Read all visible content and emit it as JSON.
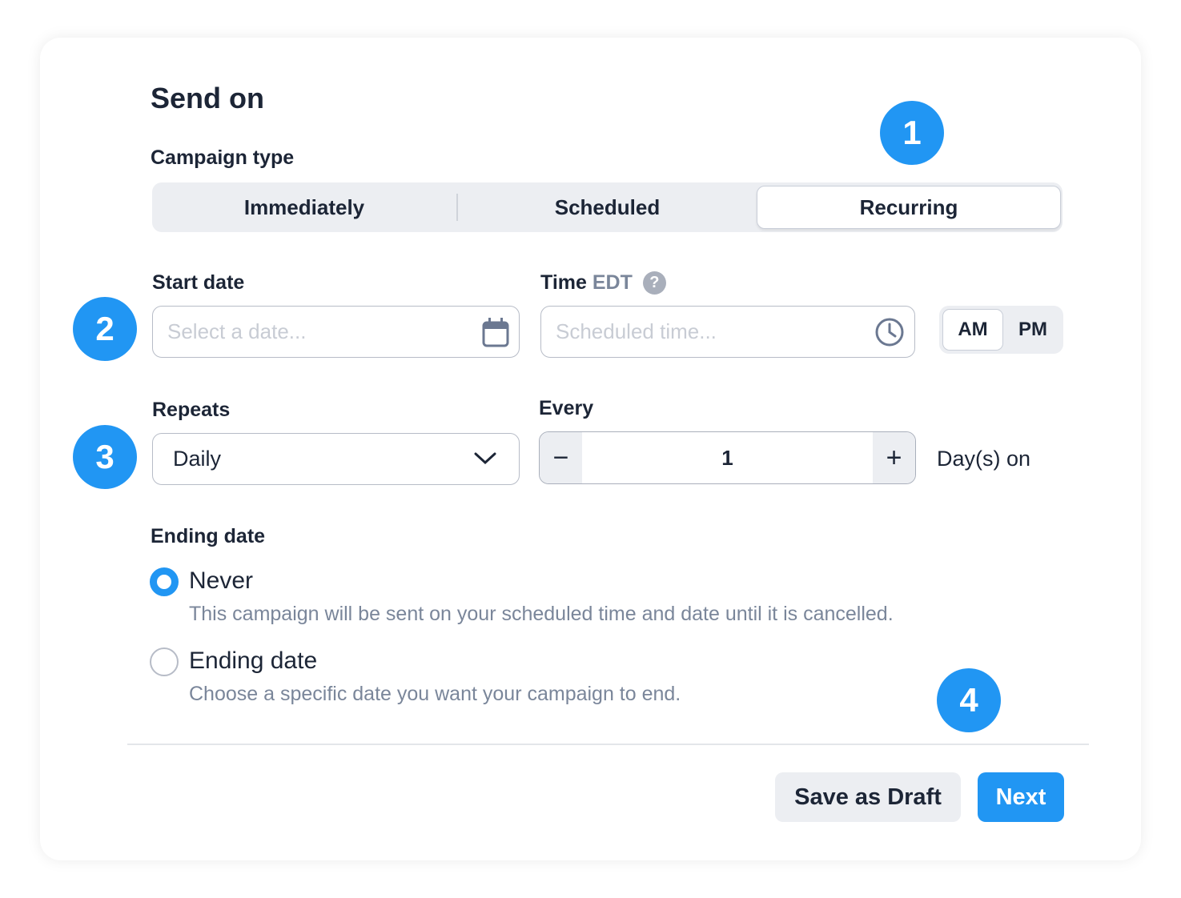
{
  "title": "Send on",
  "campaign_type": {
    "label": "Campaign type",
    "options": [
      "Immediately",
      "Scheduled",
      "Recurring"
    ],
    "selected": "Recurring"
  },
  "start_date": {
    "label": "Start date",
    "placeholder": "Select a date...",
    "icon": "calendar-icon"
  },
  "time": {
    "label": "Time",
    "timezone": "EDT",
    "placeholder": "Scheduled time...",
    "icon": "clock-icon",
    "help_icon": "question-circle-icon"
  },
  "meridiem": {
    "options": [
      "AM",
      "PM"
    ],
    "selected": "AM"
  },
  "repeats": {
    "label": "Repeats",
    "value": "Daily"
  },
  "every": {
    "label": "Every",
    "value": "1",
    "decrement": "−",
    "increment": "+",
    "suffix": "Day(s) on"
  },
  "ending": {
    "label": "Ending date",
    "options": [
      {
        "label": "Never",
        "description": "This campaign will be sent on your scheduled time and date until it is cancelled.",
        "selected": true
      },
      {
        "label": "Ending date",
        "description": "Choose a specific date you want your campaign to end.",
        "selected": false
      }
    ]
  },
  "actions": {
    "save_draft": "Save as Draft",
    "next": "Next"
  },
  "badges": [
    "1",
    "2",
    "3",
    "4"
  ],
  "colors": {
    "accent": "#2196f3",
    "text": "#1c2536",
    "muted": "#7a869a",
    "segment_bg": "#eceef2"
  }
}
